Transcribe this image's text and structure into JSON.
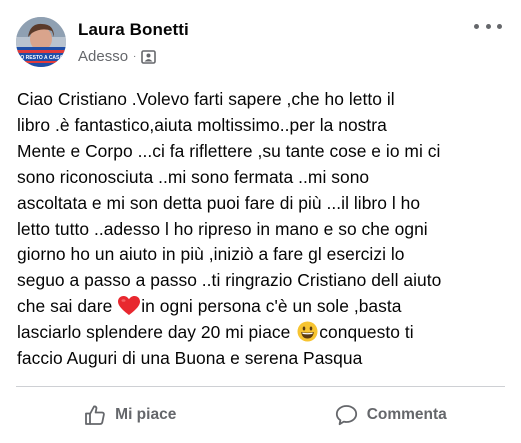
{
  "post": {
    "author": "Laura Bonetti",
    "timestamp": "Adesso",
    "separator": "·",
    "audience_icon": "group-icon",
    "more_icon": "more-horizontal-icon",
    "avatar_banner_text": "IO RESTO A CASA",
    "text_lines": [
      "Ciao Cristiano .Volevo farti sapere ,che ho letto il",
      "libro .è fantastico,aiuta moltissimo..per la nostra",
      "Mente e Corpo ...ci fa riflettere ,su tante cose e io mi ci",
      "sono riconosciuta ..mi sono fermata ..mi sono",
      "ascoltata e mi son detta puoi fare di più ...il libro l ho",
      "letto tutto ..adesso l ho ripreso in mano e so che ogni",
      "giorno ho un aiuto in più ,iniziò a fare gl esercizi lo",
      "seguo a passo a passo ..ti ringrazio Cristiano dell aiuto",
      "che sai dare ",
      "in ogni persona c'è un sole ,basta",
      "lasciarlo splendere day 20 mi piace ",
      "conquesto ti",
      "faccio Auguri di una Buona e serena Pasqua"
    ],
    "emoji_heart": "red-heart-emoji",
    "emoji_smile": "grinning-face-emoji"
  },
  "actions": {
    "like_label": "Mi piace",
    "comment_label": "Commenta",
    "like_icon": "thumbs-up-icon",
    "comment_icon": "comment-bubble-icon"
  },
  "colors": {
    "text_primary": "#050505",
    "text_secondary": "#65676b",
    "divider": "#ced0d4",
    "heart": "#e8282f",
    "smile": "#f7c431"
  }
}
